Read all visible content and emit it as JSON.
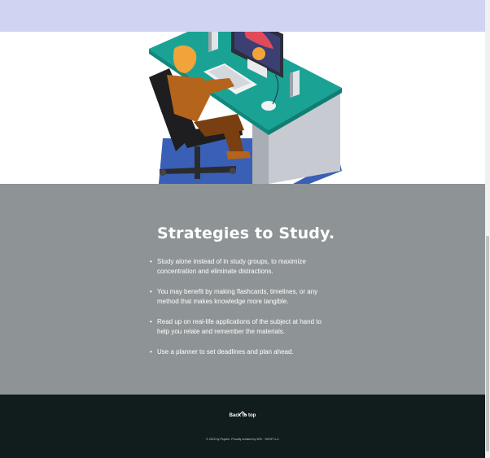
{
  "content": {
    "heading": "Strategies to Study.",
    "tips": [
      "Study alone instead of in study groups, to maximize concentration and eliminate distractions.",
      "You may benefit by making flashcards, timelines, or any method that makes knowledge more tangible.",
      "Read up on real-life applications of the subject at hand to help you relate and remember the materials.",
      "Use a planner to set deadlines and plan ahead."
    ]
  },
  "footer": {
    "back_to_top": "Back to top",
    "credit": "© 2023 by Psyche. Proudly created by WIX · SHOP LLC"
  },
  "colors": {
    "top_band": "#d0d3f2",
    "content_bg": "#8e9496",
    "footer_bg": "#111c1c",
    "desk_top": "#1aa395",
    "chair": "#1e1e20",
    "person": "#f2a33a"
  }
}
